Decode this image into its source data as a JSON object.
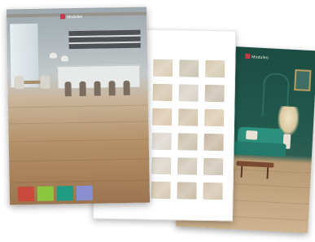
{
  "brochures": {
    "front": {
      "logo_text": "Moduleo",
      "caption_text": "",
      "chips": [
        {
          "color": "#c94a3c"
        },
        {
          "color": "#8cc63e"
        },
        {
          "color": "#1f9a83"
        },
        {
          "color": "#8a8fd0"
        }
      ]
    },
    "middle": {
      "heading_text": "",
      "footer_text": "",
      "swatches": [
        "#d8cbb3",
        "#cbc2b0",
        "#d4c8ae",
        "#d2c5ab",
        "#d6d1c6",
        "#c9bfae",
        "#dbc6ad",
        "#cfc2a9",
        "#d9c9ae",
        "#dad5cc",
        "#cbbfab",
        "#c6b7a0",
        "#d9d2c5",
        "#d0c6b6",
        "#cdc3b3",
        "#d6c7b0",
        "#c9bca6",
        "#d3c5ae"
      ]
    },
    "back": {
      "logo_text": "Moduleo",
      "footer_text": ""
    }
  },
  "colors": {
    "brand_red": "#c9374a",
    "green_wall": "#1c4d42",
    "wood_floor": "#cdb38e"
  }
}
